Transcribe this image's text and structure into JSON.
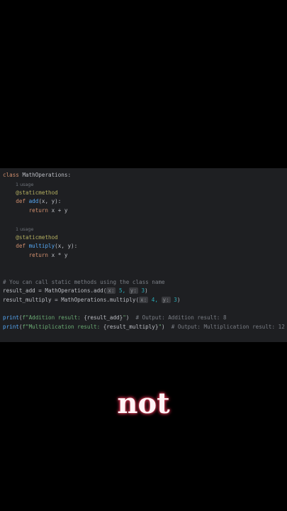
{
  "code": {
    "l1_kw": "class",
    "l1_name": "MathOperations:",
    "usage_hint_1": "1 usage",
    "l3_decorator": "@staticmethod",
    "l4_kw": "def",
    "l4_fn": "add",
    "l4_params": "(x, y):",
    "l5_kw": "return",
    "l5_expr": "x + y",
    "usage_hint_2": "1 usage",
    "l7_decorator": "@staticmethod",
    "l8_kw": "def",
    "l8_fn": "multiply",
    "l8_params": "(x, y):",
    "l9_kw": "return",
    "l9_expr": "x * y",
    "comment": "# You can call static methods using the class name",
    "l11_lhs": "result_add = MathOperations.add(",
    "l11_hint_x": "x:",
    "l11_arg1": "5,",
    "l11_hint_y": "y:",
    "l11_arg2": "3",
    "l11_close": ")",
    "l12_lhs": "result_multiply = MathOperations.multiply(",
    "l12_hint_x": "x:",
    "l12_arg1": "4,",
    "l12_hint_y": "y:",
    "l12_arg2": "3",
    "l12_close": ")",
    "l13_print": "print",
    "l13_open": "(",
    "l13_fstr": "f\"Addition result: ",
    "l13_var": "{result_add}",
    "l13_endstr": "\"",
    "l13_close": ")",
    "l13_comment": "# Output: Addition result: 8",
    "l14_print": "print",
    "l14_open": "(",
    "l14_fstr": "f\"Multiplication result: ",
    "l14_var": "{result_multiply}",
    "l14_endstr": "\"",
    "l14_close": ")",
    "l14_comment": "# Output: Multiplication result: 12"
  },
  "caption": "not"
}
